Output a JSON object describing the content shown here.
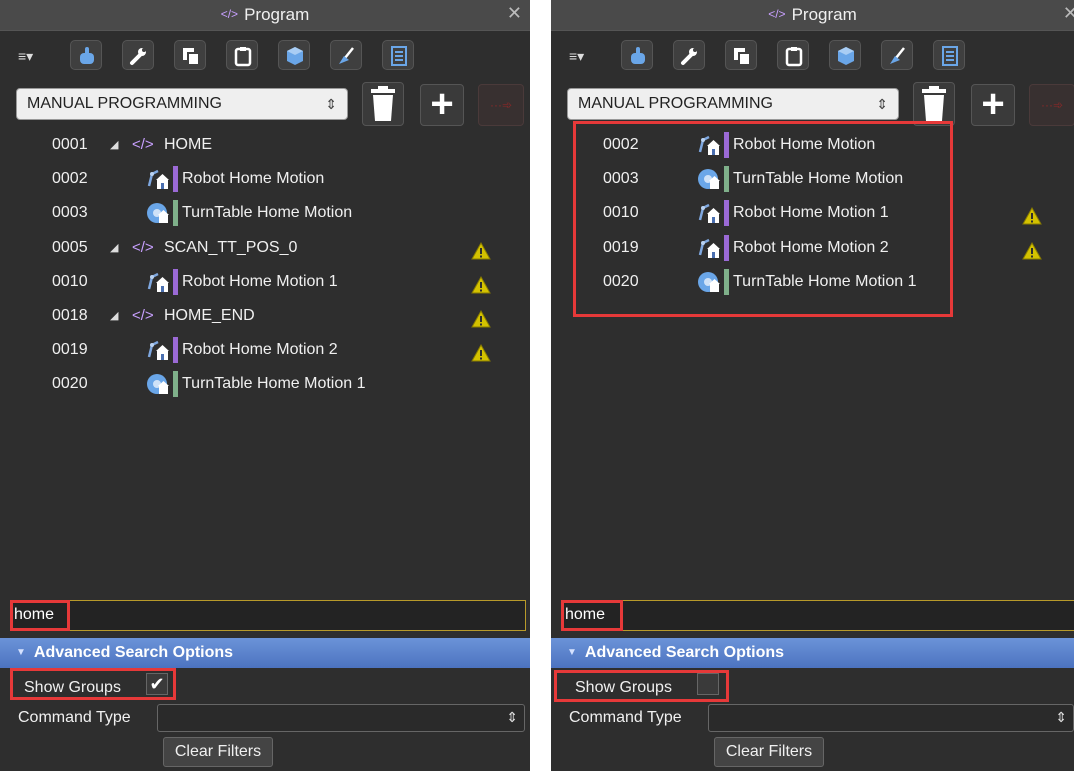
{
  "colors": {
    "panel_bg": "#2e2e2e",
    "header_bg": "#4a4a4a",
    "advanced_header": "#5a82cc",
    "highlight": "#e63939",
    "robot_bar": "#9b6ad6",
    "turntable_bar": "#7fb08a",
    "warning": "#d4c200"
  },
  "icons": {
    "menu": "hamburger-dropdown-icon",
    "robot_motion": "robot-home-icon",
    "turntable_motion": "turntable-home-icon",
    "group": "code-brackets-icon",
    "warning": "warning-triangle-icon",
    "delete": "trash-icon",
    "add": "plus-icon",
    "run": "run-arrow-icon"
  },
  "left": {
    "title": "Program",
    "close": "✕",
    "program_select": "MANUAL PROGRAMMING",
    "search_value": "home",
    "advanced_header": "Advanced Search Options",
    "show_groups_label": "Show Groups",
    "show_groups_checked": true,
    "checkmark": "✔",
    "command_type_label": "Command Type",
    "clear_filters": "Clear Filters",
    "rows": [
      {
        "num": "0001",
        "label": "HOME",
        "kind": "group",
        "warning": false
      },
      {
        "num": "0002",
        "label": "Robot Home Motion",
        "kind": "robot",
        "warning": false
      },
      {
        "num": "0003",
        "label": "TurnTable Home Motion",
        "kind": "turntable",
        "warning": false
      },
      {
        "num": "0005",
        "label": "SCAN_TT_POS_0",
        "kind": "group",
        "warning": true
      },
      {
        "num": "0010",
        "label": "Robot Home Motion 1",
        "kind": "robot",
        "warning": true
      },
      {
        "num": "0018",
        "label": "HOME_END",
        "kind": "group",
        "warning": true
      },
      {
        "num": "0019",
        "label": "Robot Home Motion 2",
        "kind": "robot",
        "warning": true
      },
      {
        "num": "0020",
        "label": "TurnTable Home Motion 1",
        "kind": "turntable",
        "warning": false
      }
    ]
  },
  "right": {
    "title": "Program",
    "close": "✕",
    "program_select": "MANUAL PROGRAMMING",
    "search_value": "home",
    "advanced_header": "Advanced Search Options",
    "show_groups_label": "Show Groups",
    "show_groups_checked": false,
    "checkmark": "",
    "command_type_label": "Command Type",
    "clear_filters": "Clear Filters",
    "rows": [
      {
        "num": "0002",
        "label": "Robot Home Motion",
        "kind": "robot",
        "warning": false
      },
      {
        "num": "0003",
        "label": "TurnTable Home Motion",
        "kind": "turntable",
        "warning": false
      },
      {
        "num": "0010",
        "label": "Robot Home Motion 1",
        "kind": "robot",
        "warning": true
      },
      {
        "num": "0019",
        "label": "Robot Home Motion 2",
        "kind": "robot",
        "warning": true
      },
      {
        "num": "0020",
        "label": "TurnTable Home Motion 1",
        "kind": "turntable",
        "warning": false
      }
    ]
  }
}
